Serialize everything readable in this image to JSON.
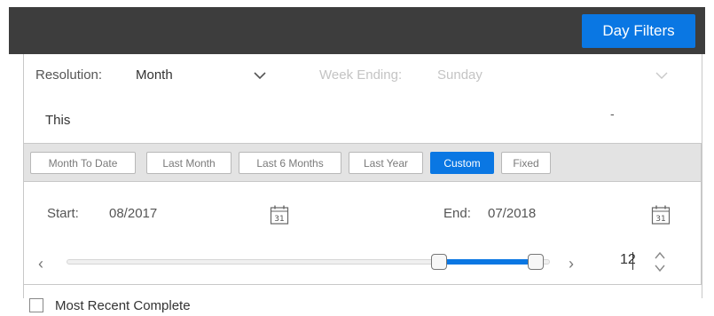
{
  "header": {
    "day_filters_label": "Day Filters"
  },
  "resolution": {
    "label": "Resolution:",
    "value": "Month"
  },
  "week_ending": {
    "label": "Week Ending:",
    "value": "Sunday"
  },
  "this_row": {
    "label": "This",
    "dash": "-"
  },
  "tabs": [
    {
      "label": "Month To Date",
      "active": false
    },
    {
      "label": "Last Month",
      "active": false
    },
    {
      "label": "Last 6 Months",
      "active": false
    },
    {
      "label": "Last Year",
      "active": false
    },
    {
      "label": "Custom",
      "active": true
    },
    {
      "label": "Fixed",
      "active": false
    }
  ],
  "range": {
    "start_label": "Start:",
    "start_value": "08/2017",
    "end_label": "End:",
    "end_value": "07/2018",
    "calendar_day": "31",
    "months_value": "12",
    "slider_low_fraction": 0.77,
    "slider_high_fraction": 0.97
  },
  "most_recent": {
    "label": "Most Recent Complete",
    "checked": false
  },
  "colors": {
    "accent": "#0a77e3",
    "topbar": "#3d3d3d",
    "tab_strip": "#e3e3e3"
  }
}
